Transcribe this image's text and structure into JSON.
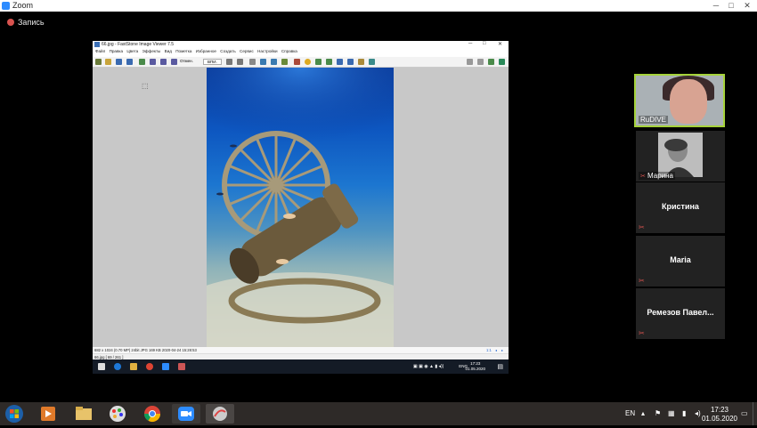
{
  "zoom": {
    "title": "Zoom",
    "recording_label": "Запись",
    "window_buttons": [
      "─",
      "□",
      "✕"
    ]
  },
  "shared_screen": {
    "viewer_title": "66.jpg - FastStone Image Viewer 7.5",
    "window_buttons": [
      "─",
      "□",
      "✕"
    ],
    "menu": [
      "Файл",
      "Правка",
      "Цвета",
      "Эффекты",
      "Вид",
      "Пометка",
      "Избранное",
      "Создать",
      "Сервис",
      "Настройки",
      "Справка"
    ],
    "zoom_field": "Отмен.",
    "fit_field": "ВПИ.",
    "status_info": "682 x 1024 (0.70 MP)  24bit  JPG  169 KB  2020-04-24 15:28:53",
    "status_zoom": "1:1",
    "status_file": "66.jpg [ 69 / 261 ]",
    "taskbar_lang": "ENG",
    "taskbar_time": "17:23",
    "taskbar_date": "01.05.2020"
  },
  "participants": [
    {
      "name": "RuDIVE",
      "active": true,
      "has_video": true
    },
    {
      "name": "Марина",
      "active": false,
      "has_video": true,
      "muted": true
    },
    {
      "name": "Кристина",
      "active": false,
      "has_video": false,
      "muted": true
    },
    {
      "name": "Maria",
      "active": false,
      "has_video": false,
      "muted": true
    },
    {
      "name": "Ремезов Павел...",
      "active": false,
      "has_video": false,
      "muted": true
    }
  ],
  "taskbar": {
    "lang": "EN",
    "time": "17:23",
    "date": "01.05.2020"
  },
  "colors": {
    "active_speaker_border": "#a5d23a",
    "muted_icon": "#d9534f",
    "zoom_blue": "#2d8cff"
  }
}
